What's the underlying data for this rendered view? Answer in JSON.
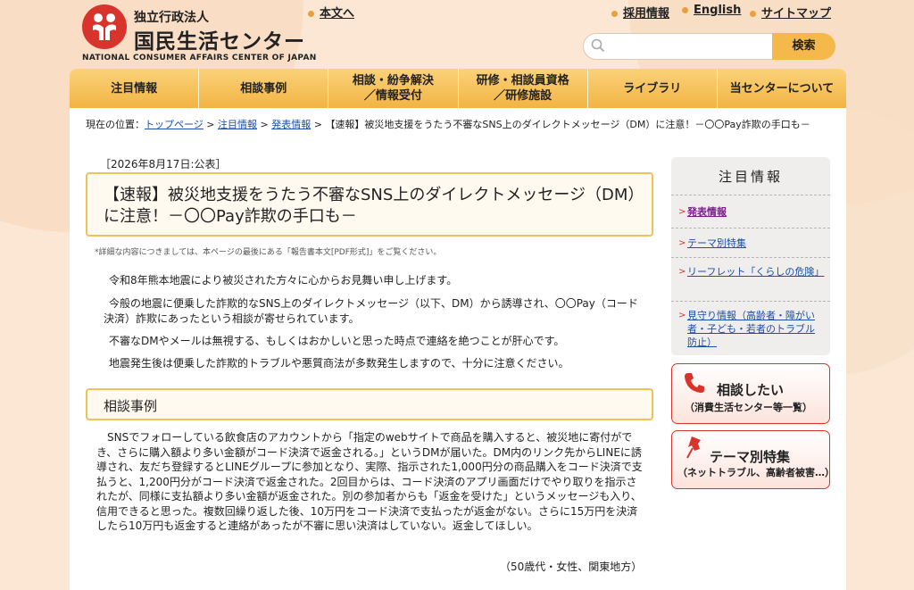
{
  "header": {
    "org_small": "独立行政法人",
    "org_big": "国民生活センター",
    "org_en": "NATIONAL CONSUMER AFFAIRS CENTER OF JAPAN",
    "link_text_version": "本文へ",
    "link_recruit": "採用情報",
    "link_english": "English",
    "link_sitemap": "サイトマップ",
    "search_placeholder": "",
    "search_button": "検索"
  },
  "nav": [
    {
      "label": "注目情報"
    },
    {
      "label": "相談事例"
    },
    {
      "label": "相談・紛争解決\n／情報受付"
    },
    {
      "label": "研修・相談員資格\n／研修施設"
    },
    {
      "label": "ライブラリ"
    },
    {
      "label": "当センターについて"
    }
  ],
  "breadcrumb": {
    "prefix": "現在の位置：",
    "items": [
      "トップページ",
      "注目情報",
      "発表情報"
    ],
    "current": "【速報】被災地支援をうたう不審なSNS上のダイレクトメッセージ（DM）に注意！－〇〇Pay詐欺の手口も－"
  },
  "article": {
    "date": "［2026年8月17日:公表］",
    "title": "【速報】被災地支援をうたう不審なSNS上のダイレクトメッセージ（DM）に注意！－〇〇Pay詐欺の手口も－",
    "note": "*詳細な内容につきましては、本ページの最後にある「報告書本文[PDF形式]」をご覧ください。",
    "paragraphs": [
      "令和8年熊本地震により被災された方々に心からお見舞い申し上げます。",
      "今般の地震に便乗した詐欺的なSNS上のダイレクトメッセージ（以下、DM）から誘導され、〇〇Pay（コード決済）詐欺にあったという相談が寄せられています。",
      "不審なDMやメールは無視する、もしくはおかしいと思った時点で連絡を絶つことが肝心です。",
      "地震発生後は便乗した詐欺的トラブルや悪質商法が多数発生しますので、十分に注意ください。"
    ],
    "section_heading": "相談事例",
    "case_text": "SNSでフォローしている飲食店のアカウントから「指定のwebサイトで商品を購入すると、被災地に寄付ができ、さらに購入額より多い金額がコード決済で返金される。」というDMが届いた。DM内のリンク先からLINEに誘導され、友だち登録するとLINEグループに参加となり、実際、指示された1,000円分の商品購入をコード決済で支払うと、1,200円分がコード決済で返金された。2回目からは、コード決済のアプリ画面だけでやり取りを指示されたが、同様に支払額より多い金額が返金された。別の参加者からも「返金を受けた」というメッセージも入り、信用できると思った。複数回繰り返した後、10万円をコード決済で支払ったが返金がない。さらに15万円を決済したら10万円も返金すると連絡があったが不審に思い決済はしていない。返金してほしい。",
    "case_meta": "（50歳代・女性、関東地方）"
  },
  "sidebar": {
    "heading": "注目情報",
    "items": [
      {
        "label": "発表情報"
      },
      {
        "label": "テーマ別特集"
      },
      {
        "label": "リーフレット「くらしの危険」"
      },
      {
        "label": "見守り情報（高齢者・障がい者・子ども・若者のトラブル防止）"
      }
    ],
    "consult_title": "相談したい",
    "consult_sub": "（消費生活センター等一覧）",
    "theme_title": "テーマ別特集",
    "theme_sub": "（ネットトラブル、高齢者被害…）"
  },
  "colors": {
    "brand_red": "#d9342b",
    "nav_orange": "#f2b443",
    "link_blue": "#1f4fa8"
  }
}
